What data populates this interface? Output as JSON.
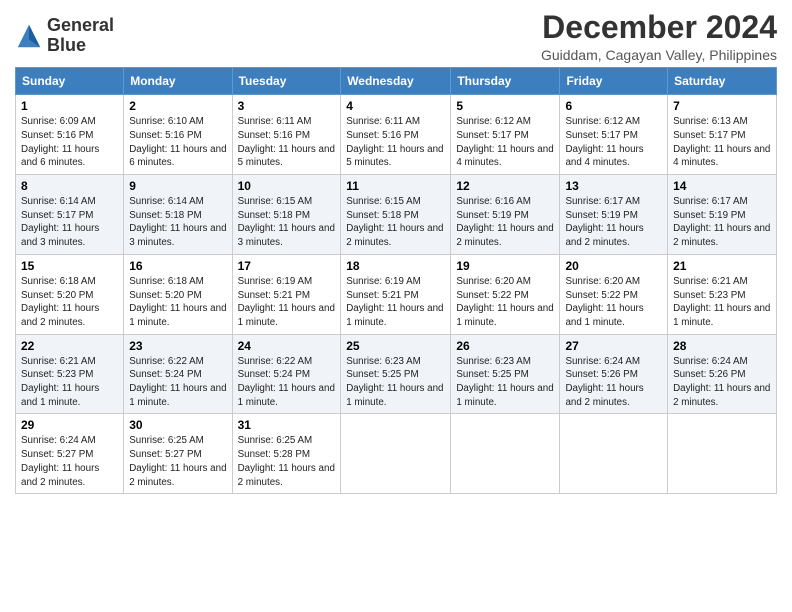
{
  "logo": {
    "line1": "General",
    "line2": "Blue"
  },
  "title": "December 2024",
  "subtitle": "Guiddam, Cagayan Valley, Philippines",
  "days_of_week": [
    "Sunday",
    "Monday",
    "Tuesday",
    "Wednesday",
    "Thursday",
    "Friday",
    "Saturday"
  ],
  "weeks": [
    [
      {
        "day": "1",
        "info": "Sunrise: 6:09 AM\nSunset: 5:16 PM\nDaylight: 11 hours and 6 minutes."
      },
      {
        "day": "2",
        "info": "Sunrise: 6:10 AM\nSunset: 5:16 PM\nDaylight: 11 hours and 6 minutes."
      },
      {
        "day": "3",
        "info": "Sunrise: 6:11 AM\nSunset: 5:16 PM\nDaylight: 11 hours and 5 minutes."
      },
      {
        "day": "4",
        "info": "Sunrise: 6:11 AM\nSunset: 5:16 PM\nDaylight: 11 hours and 5 minutes."
      },
      {
        "day": "5",
        "info": "Sunrise: 6:12 AM\nSunset: 5:17 PM\nDaylight: 11 hours and 4 minutes."
      },
      {
        "day": "6",
        "info": "Sunrise: 6:12 AM\nSunset: 5:17 PM\nDaylight: 11 hours and 4 minutes."
      },
      {
        "day": "7",
        "info": "Sunrise: 6:13 AM\nSunset: 5:17 PM\nDaylight: 11 hours and 4 minutes."
      }
    ],
    [
      {
        "day": "8",
        "info": "Sunrise: 6:14 AM\nSunset: 5:17 PM\nDaylight: 11 hours and 3 minutes."
      },
      {
        "day": "9",
        "info": "Sunrise: 6:14 AM\nSunset: 5:18 PM\nDaylight: 11 hours and 3 minutes."
      },
      {
        "day": "10",
        "info": "Sunrise: 6:15 AM\nSunset: 5:18 PM\nDaylight: 11 hours and 3 minutes."
      },
      {
        "day": "11",
        "info": "Sunrise: 6:15 AM\nSunset: 5:18 PM\nDaylight: 11 hours and 2 minutes."
      },
      {
        "day": "12",
        "info": "Sunrise: 6:16 AM\nSunset: 5:19 PM\nDaylight: 11 hours and 2 minutes."
      },
      {
        "day": "13",
        "info": "Sunrise: 6:17 AM\nSunset: 5:19 PM\nDaylight: 11 hours and 2 minutes."
      },
      {
        "day": "14",
        "info": "Sunrise: 6:17 AM\nSunset: 5:19 PM\nDaylight: 11 hours and 2 minutes."
      }
    ],
    [
      {
        "day": "15",
        "info": "Sunrise: 6:18 AM\nSunset: 5:20 PM\nDaylight: 11 hours and 2 minutes."
      },
      {
        "day": "16",
        "info": "Sunrise: 6:18 AM\nSunset: 5:20 PM\nDaylight: 11 hours and 1 minute."
      },
      {
        "day": "17",
        "info": "Sunrise: 6:19 AM\nSunset: 5:21 PM\nDaylight: 11 hours and 1 minute."
      },
      {
        "day": "18",
        "info": "Sunrise: 6:19 AM\nSunset: 5:21 PM\nDaylight: 11 hours and 1 minute."
      },
      {
        "day": "19",
        "info": "Sunrise: 6:20 AM\nSunset: 5:22 PM\nDaylight: 11 hours and 1 minute."
      },
      {
        "day": "20",
        "info": "Sunrise: 6:20 AM\nSunset: 5:22 PM\nDaylight: 11 hours and 1 minute."
      },
      {
        "day": "21",
        "info": "Sunrise: 6:21 AM\nSunset: 5:23 PM\nDaylight: 11 hours and 1 minute."
      }
    ],
    [
      {
        "day": "22",
        "info": "Sunrise: 6:21 AM\nSunset: 5:23 PM\nDaylight: 11 hours and 1 minute."
      },
      {
        "day": "23",
        "info": "Sunrise: 6:22 AM\nSunset: 5:24 PM\nDaylight: 11 hours and 1 minute."
      },
      {
        "day": "24",
        "info": "Sunrise: 6:22 AM\nSunset: 5:24 PM\nDaylight: 11 hours and 1 minute."
      },
      {
        "day": "25",
        "info": "Sunrise: 6:23 AM\nSunset: 5:25 PM\nDaylight: 11 hours and 1 minute."
      },
      {
        "day": "26",
        "info": "Sunrise: 6:23 AM\nSunset: 5:25 PM\nDaylight: 11 hours and 1 minute."
      },
      {
        "day": "27",
        "info": "Sunrise: 6:24 AM\nSunset: 5:26 PM\nDaylight: 11 hours and 2 minutes."
      },
      {
        "day": "28",
        "info": "Sunrise: 6:24 AM\nSunset: 5:26 PM\nDaylight: 11 hours and 2 minutes."
      }
    ],
    [
      {
        "day": "29",
        "info": "Sunrise: 6:24 AM\nSunset: 5:27 PM\nDaylight: 11 hours and 2 minutes."
      },
      {
        "day": "30",
        "info": "Sunrise: 6:25 AM\nSunset: 5:27 PM\nDaylight: 11 hours and 2 minutes."
      },
      {
        "day": "31",
        "info": "Sunrise: 6:25 AM\nSunset: 5:28 PM\nDaylight: 11 hours and 2 minutes."
      },
      null,
      null,
      null,
      null
    ]
  ]
}
